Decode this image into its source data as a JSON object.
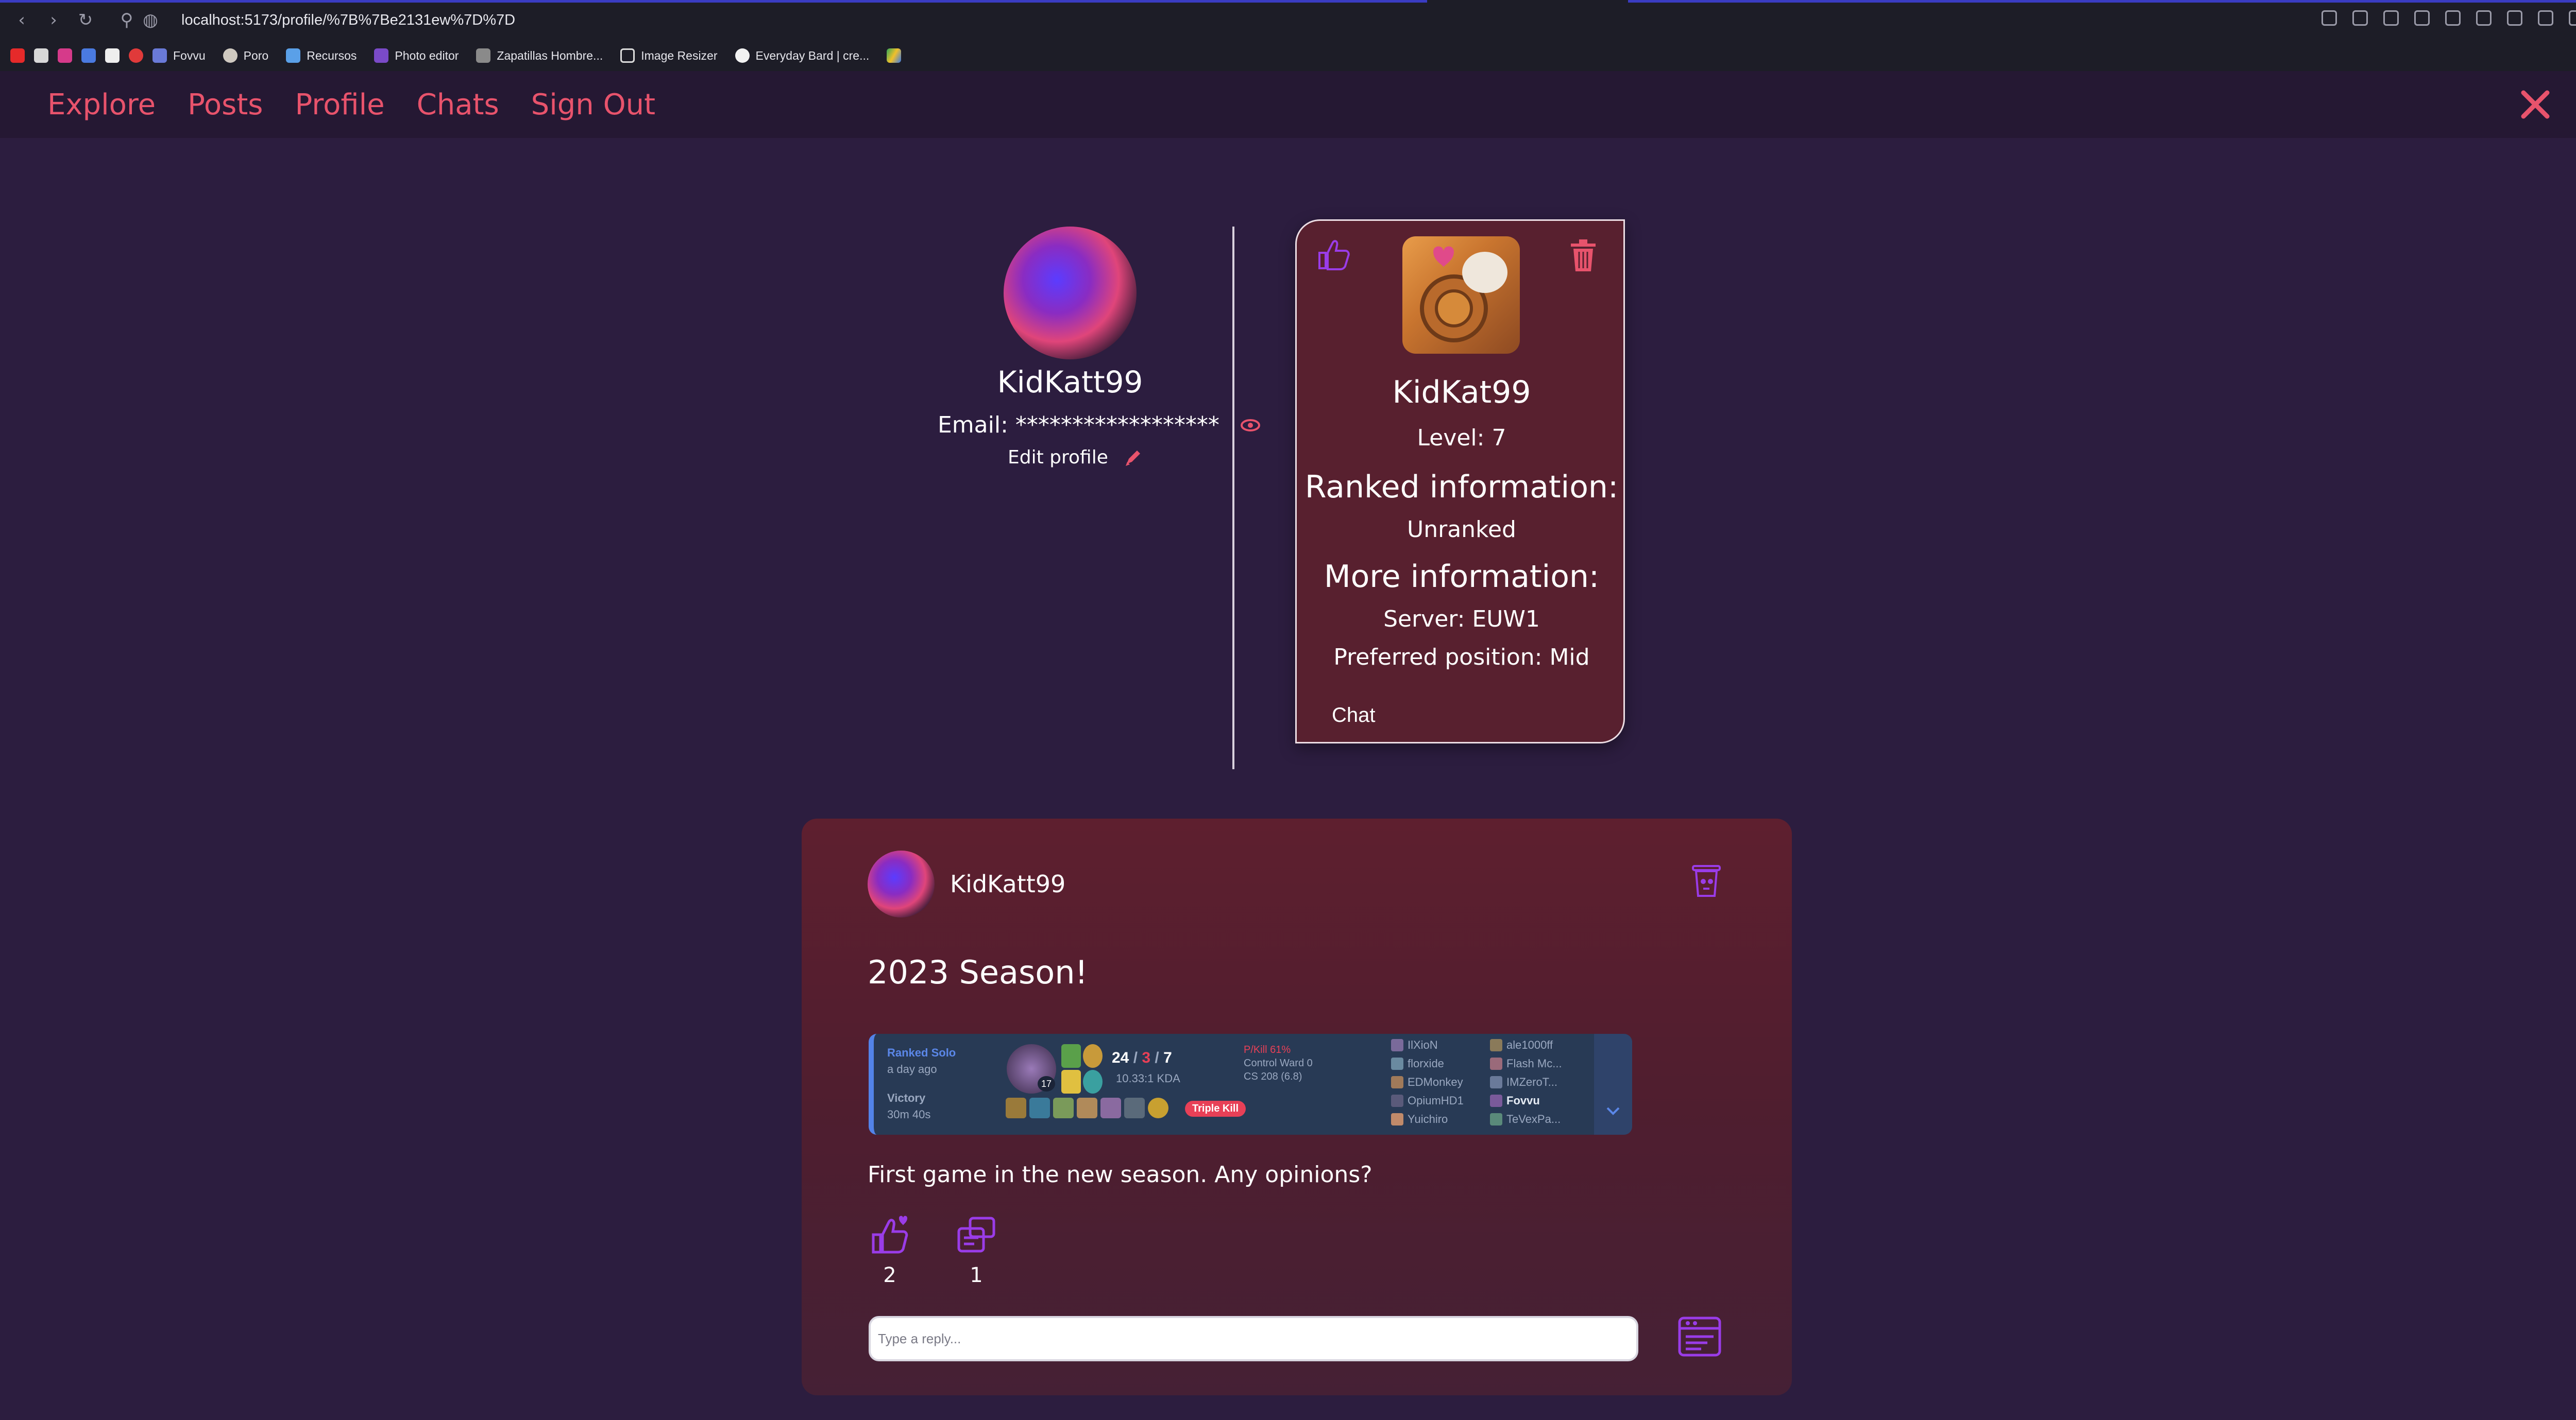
{
  "browser": {
    "url": "localhost:5173/profile/%7B%7Be2131ew%7D%7D",
    "bookmarks": [
      "Fovvu",
      "Poro",
      "Recursos",
      "Photo editor",
      "Zapatillas Hombre...",
      "Image Resizer",
      "Everyday Bard | cre..."
    ]
  },
  "nav": {
    "links": [
      "Explore",
      "Posts",
      "Profile",
      "Chats",
      "Sign Out"
    ]
  },
  "profile": {
    "username": "KidKatt99",
    "email_label": "Email:",
    "email_masked": "******************",
    "edit_label": "Edit profile"
  },
  "summoner": {
    "name": "KidKat99",
    "level": "Level: 7",
    "ranked_heading": "Ranked information:",
    "ranked_value": "Unranked",
    "more_heading": "More information:",
    "server": "Server: EUW1",
    "position": "Preferred position: Mid",
    "chat_label": "Chat"
  },
  "post": {
    "author": "KidKatt99",
    "title": "2023 Season!",
    "body": "First game in the new season. Any opinions?",
    "likes": "2",
    "comments": "1",
    "reply_placeholder": "Type a reply...",
    "match": {
      "queue": "Ranked Solo",
      "when": "a day ago",
      "result": "Victory",
      "duration": "30m 40s",
      "champ_level": "17",
      "kills": "24",
      "deaths": "3",
      "assists": "7",
      "kda": "10.33:1 KDA",
      "pkill": "P/Kill 61%",
      "wards": "Control Ward 0",
      "cs": "CS 208 (6.8)",
      "badge": "Triple Kill",
      "team1": [
        "IlXioN",
        "florxide",
        "EDMonkey",
        "OpiumHD1",
        "Yuichiro"
      ],
      "team2": [
        "ale1000ff",
        "Flash Mc...",
        "IMZeroT...",
        "Fovvu",
        "TeVexPa..."
      ]
    }
  },
  "colors": {
    "background": "#2c1d3f",
    "accent": "#e8536c",
    "card": "#58202f",
    "icon_purple": "#9a3ce8"
  }
}
